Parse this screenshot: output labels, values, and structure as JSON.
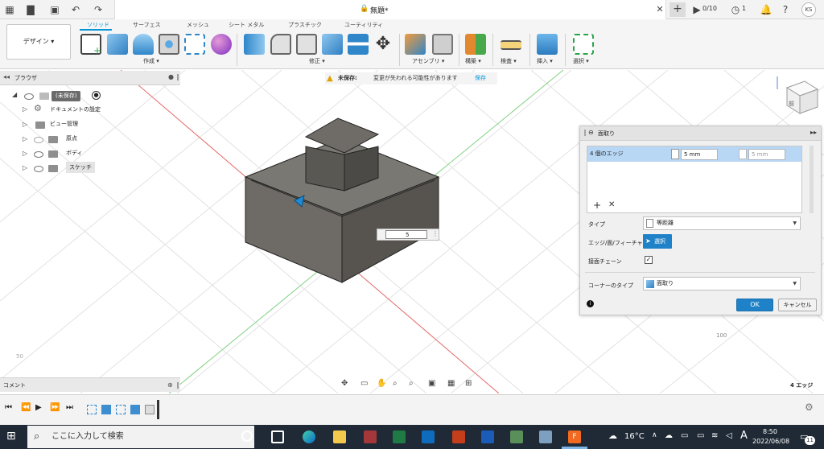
{
  "titlebar": {
    "doc_title": "無題*",
    "jobs_count": "0/10",
    "notif_count": "1",
    "user_initials": "KS"
  },
  "toolbar": {
    "workspace": "デザイン ▾",
    "tabs": [
      "ソリッド",
      "サーフェス",
      "メッシュ",
      "シート メタル",
      "プラスチック",
      "ユーティリティ"
    ],
    "groups": {
      "create": "作成 ▾",
      "modify": "修正 ▾",
      "assemble": "アセンブリ ▾",
      "construct": "構築 ▾",
      "inspect": "検査 ▾",
      "insert": "挿入 ▾",
      "select": "選択 ▾"
    }
  },
  "browser": {
    "title": "ブラウザ",
    "root": "(未保存)",
    "items": [
      "ドキュメントの設定",
      "ビュー管理",
      "原点",
      "ボディ",
      "スケッチ"
    ]
  },
  "warning": {
    "label": "未保存:",
    "message": "変更が失われる可能性があります",
    "save": "保存"
  },
  "viewport": {
    "dim_input": "5",
    "viewcube_face": "前",
    "grid_label": "100",
    "grid_label_left": "50",
    "selection_count": "4 エッジ"
  },
  "chamfer": {
    "title": "面取り",
    "edges_label": "4 個のエッジ",
    "distance1": "5 mm",
    "distance2": "5 mm",
    "type_label": "タイプ",
    "type_value": "等距離",
    "edge_label": "エッジ/面/フィーチャ",
    "select_btn": "選択",
    "tangent_label": "接面チェーン",
    "corner_label": "コーナーのタイプ",
    "corner_value": "面取り",
    "ok": "OK",
    "cancel": "キャンセル"
  },
  "comments": {
    "title": "コメント"
  },
  "taskbar": {
    "search_placeholder": "ここに入力して検索",
    "temperature": "16°C",
    "ime": "A",
    "time": "8:50",
    "date": "2022/06/08",
    "notif_badge": "11"
  }
}
